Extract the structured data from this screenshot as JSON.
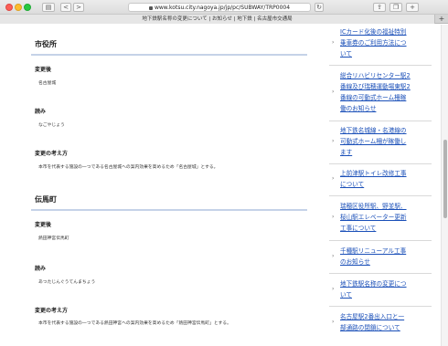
{
  "browser": {
    "address": "www.kotsu.city.nagoya.jp/jp/pc/SUBWAY/TRP0004",
    "tab_title": "地下鉄駅名称の変更について | お知らせ | 地下鉄 | 名古屋市交通局",
    "back_icon": "<",
    "forward_icon": ">",
    "new_tab_icon": "+"
  },
  "sections": [
    {
      "title": "市役所",
      "after_label": "変更後",
      "after_value": "名古屋城",
      "reading_label": "読み",
      "reading_value": "なごやじょう",
      "reason_label": "変更の考え方",
      "reason_value": "本市を代表する施設の一つである名古屋城への案内効果を高めるため「名古屋城」とする。"
    },
    {
      "title": "伝馬町",
      "after_label": "変更後",
      "after_value": "熱田神宮伝馬町",
      "reading_label": "読み",
      "reading_value": "あつたじんぐうてんまちょう",
      "reason_label": "変更の考え方",
      "reason_value": "本市を代表する施設の一つである熱田神宮への案内効果を高めるため「熱田神宮伝馬町」とする。"
    }
  ],
  "sidebar": {
    "links": [
      {
        "lines": [
          "ICカード化後の福祉特別",
          "乗車券のご利用方法につ",
          "いて"
        ]
      },
      {
        "lines": [
          "総合リハビリセンター駅2",
          "番線及び瑞穂運動場東駅2",
          "番線の可動式ホーム柵稼",
          "働のお知らせ"
        ]
      },
      {
        "lines": [
          "地下鉄名城線・名港線の",
          "可動式ホーム柵が稼働し",
          "ます"
        ]
      },
      {
        "lines": [
          "上前津駅トイレ改修工事",
          "について"
        ]
      },
      {
        "lines": [
          "瑞穂区役所駅、野並駅、",
          "桜山駅エレベーター更新",
          "工事について"
        ]
      },
      {
        "lines": [
          "千種駅リニューアル工事",
          "のお知らせ"
        ]
      },
      {
        "lines": [
          "地下鉄駅名称の変更につ",
          "いて"
        ]
      },
      {
        "lines": [
          "名古屋駅2番出入口と一",
          "部通路の閉鎖について"
        ]
      }
    ]
  }
}
